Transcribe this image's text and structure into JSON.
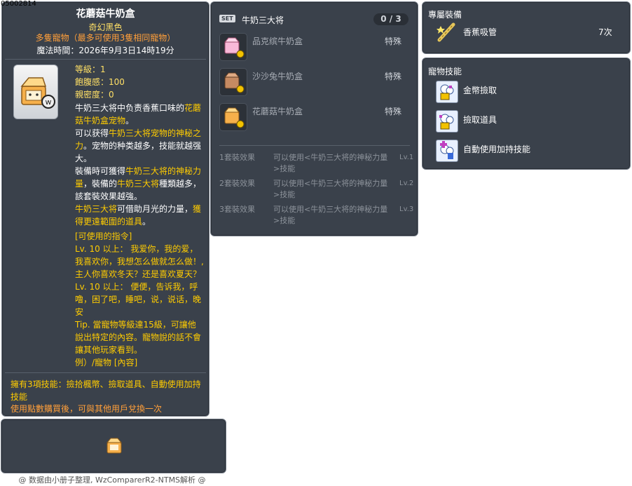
{
  "item_id": "05002814",
  "main": {
    "name": "花蘑菇牛奶盒",
    "grade": "奇幻黑色",
    "limit": "多隻寵物（最多可使用3隻相同寵物）",
    "expire": "魔法時間：2026年9月3日14時19分",
    "stats": [
      "等級：1",
      "飽腹感：100",
      "親密度：0"
    ],
    "desc": [
      {
        "parts": [
          {
            "t": "牛奶三大将中负责香蕉口味的",
            "c": "white"
          },
          {
            "t": "花蘑",
            "c": "yellow"
          }
        ]
      },
      {
        "parts": [
          {
            "t": "菇牛奶盒宠物",
            "c": "yellow"
          },
          {
            "t": "。",
            "c": "white"
          }
        ]
      },
      {
        "parts": [
          {
            "t": "可以获得",
            "c": "white"
          },
          {
            "t": "牛奶三大将宠物的神秘之",
            "c": "yellow"
          }
        ]
      },
      {
        "parts": [
          {
            "t": "力",
            "c": "yellow"
          },
          {
            "t": "。宠物的种类越多，技能就越强",
            "c": "white"
          }
        ]
      },
      {
        "parts": [
          {
            "t": "大。",
            "c": "white"
          }
        ]
      },
      {
        "parts": [
          {
            "t": "裝備時可獲得",
            "c": "white"
          },
          {
            "t": "牛奶三大将的神秘力",
            "c": "yellow"
          }
        ]
      },
      {
        "parts": [
          {
            "t": "量",
            "c": "yellow"
          },
          {
            "t": "，裝備的",
            "c": "white"
          },
          {
            "t": "牛奶三大将",
            "c": "yellow"
          },
          {
            "t": "種類越多，",
            "c": "white"
          }
        ]
      },
      {
        "parts": [
          {
            "t": "該套裝效果越強。",
            "c": "white"
          }
        ]
      },
      {
        "parts": [
          {
            "t": "牛奶三大将",
            "c": "yellow"
          },
          {
            "t": "可借助月光的力量，",
            "c": "white"
          },
          {
            "t": "獲",
            "c": "yellow"
          }
        ]
      },
      {
        "parts": [
          {
            "t": "得更遠範圍的道具",
            "c": "yellow"
          },
          {
            "t": "。",
            "c": "white"
          }
        ]
      }
    ],
    "commands": [
      "[可使用的指令]",
      "Lv. 10 以上： 我爱你，我的爱，",
      "我喜欢你，我想怎么做就怎么做！,",
      "主人你喜欢冬天？还是喜欢夏天？",
      "Lv. 10 以上： 便便，告诉我，呼",
      "噜，困了吧，睡吧，说，说话，晚",
      "安",
      "Tip. 當寵物等級達15級，可讓他",
      "說出特定的內容。寵物說的話不會",
      "讓其他玩家看到。",
      "例）/寵物 [內容]"
    ],
    "skills_note": [
      "擁有3項技能：撿拾楓幣、撿取道具、自動使用加持",
      "技能"
    ],
    "trade_note": "使用點數購買後，可與其他用戶兌換一次"
  },
  "set": {
    "badge": "SET",
    "name": "牛奶三大将",
    "count": "0 / 3",
    "items": [
      {
        "name": "品克缤牛奶盒",
        "tag": "特殊"
      },
      {
        "name": "沙沙兔牛奶盒",
        "tag": "特殊"
      },
      {
        "name": "花蘑菇牛奶盒",
        "tag": "特殊"
      }
    ],
    "effects": [
      {
        "label": "1套裝效果",
        "text1": "可以使用<牛奶三大将的神秘力量",
        "lv": "Lv.1",
        "text2": ">技能"
      },
      {
        "label": "2套裝效果",
        "text1": "可以使用<牛奶三大将的神秘力量",
        "lv": "Lv.2",
        "text2": ">技能"
      },
      {
        "label": "3套裝效果",
        "text1": "可以使用<牛奶三大将的神秘力量",
        "lv": "Lv.3",
        "text2": ">技能"
      }
    ]
  },
  "equip": {
    "title": "專屬裝備",
    "item_name": "香蕉吸管",
    "count": "7次"
  },
  "skills": {
    "title": "寵物技能",
    "list": [
      "金幣撿取",
      "撿取道具",
      "自動使用加持技能"
    ]
  },
  "footer": "@ 数据由小册子整理, WzComparerR2-NTMS解析 @"
}
